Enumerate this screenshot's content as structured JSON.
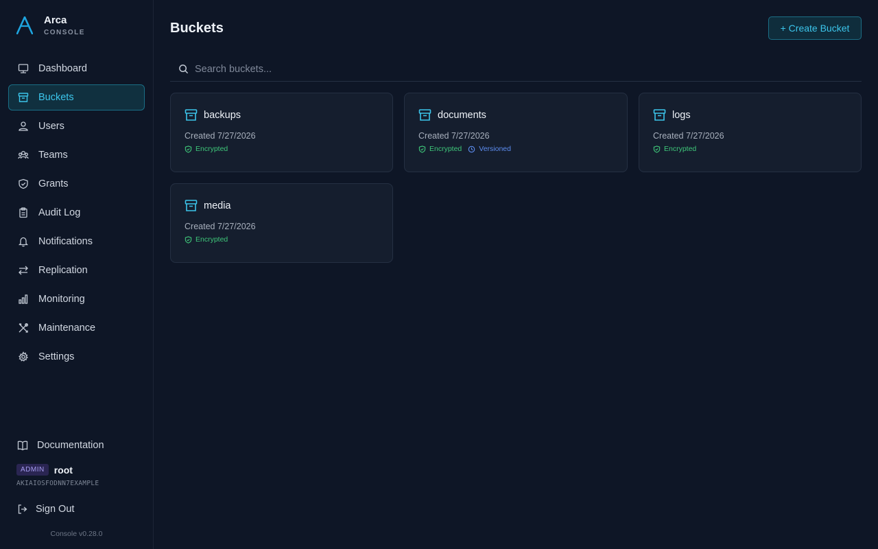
{
  "brand": {
    "name": "Arca",
    "subtitle": "CONSOLE"
  },
  "nav": [
    {
      "label": "Dashboard",
      "icon": "dashboard-icon"
    },
    {
      "label": "Buckets",
      "icon": "bucket-icon",
      "active": true
    },
    {
      "label": "Users",
      "icon": "user-icon"
    },
    {
      "label": "Teams",
      "icon": "teams-icon"
    },
    {
      "label": "Grants",
      "icon": "shield-icon"
    },
    {
      "label": "Audit Log",
      "icon": "clipboard-icon"
    },
    {
      "label": "Notifications",
      "icon": "bell-icon"
    },
    {
      "label": "Replication",
      "icon": "arrows-icon"
    },
    {
      "label": "Monitoring",
      "icon": "bar-chart-icon"
    },
    {
      "label": "Maintenance",
      "icon": "tools-icon"
    },
    {
      "label": "Settings",
      "icon": "gear-icon"
    }
  ],
  "footer": {
    "documentation": "Documentation",
    "role_badge": "ADMIN",
    "username": "root",
    "access_key": "AKIAIOSFODNN7EXAMPLE",
    "sign_out": "Sign Out",
    "version": "Console v0.28.0"
  },
  "main": {
    "title": "Buckets",
    "create_button": "+ Create Bucket",
    "search_placeholder": "Search buckets..."
  },
  "buckets": [
    {
      "name": "backups",
      "created": "Created 7/27/2026",
      "tags": [
        "Encrypted"
      ]
    },
    {
      "name": "documents",
      "created": "Created 7/27/2026",
      "tags": [
        "Encrypted",
        "Versioned"
      ]
    },
    {
      "name": "logs",
      "created": "Created 7/27/2026",
      "tags": [
        "Encrypted"
      ]
    },
    {
      "name": "media",
      "created": "Created 7/27/2026",
      "tags": [
        "Encrypted"
      ]
    }
  ],
  "colors": {
    "accent": "#3cc6ec",
    "encrypted": "#3fc77a",
    "versioned": "#5d8df0",
    "background": "#0e1626"
  }
}
